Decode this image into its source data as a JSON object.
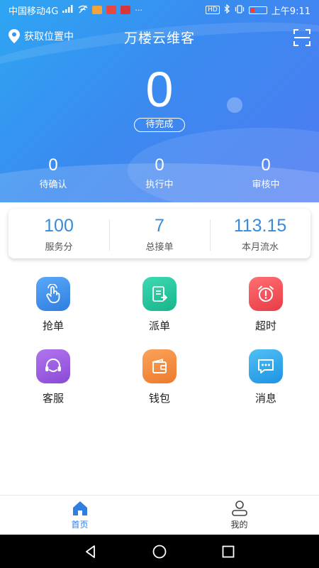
{
  "status_bar": {
    "carrier": "中国移动4G",
    "network": "4G",
    "time": "上午9:11",
    "hd_badge": "HD",
    "icons": [
      "signal-icon",
      "wifi-off-icon",
      "alert-icon",
      "app-badge-icon",
      "bluetooth-icon",
      "vibrate-icon",
      "battery-icon"
    ]
  },
  "header": {
    "location_label": "获取位置中",
    "title": "万楼云维客",
    "scan_icon": "scan-icon"
  },
  "hero": {
    "pending_count": "0",
    "pending_label": "待完成",
    "stats": [
      {
        "value": "0",
        "label": "待确认"
      },
      {
        "value": "0",
        "label": "执行中"
      },
      {
        "value": "0",
        "label": "审核中"
      }
    ]
  },
  "summary": [
    {
      "value": "100",
      "label": "服务分"
    },
    {
      "value": "7",
      "label": "总接单"
    },
    {
      "value": "113.15",
      "label": "本月流水"
    }
  ],
  "grid": [
    {
      "label": "抢单",
      "icon": "tap-hand-icon",
      "color": "#3f8ff0"
    },
    {
      "label": "派单",
      "icon": "dispatch-doc-icon",
      "color": "#26c49a"
    },
    {
      "label": "超时",
      "icon": "alarm-clock-icon",
      "color": "#f2505a"
    },
    {
      "label": "客服",
      "icon": "headset-icon",
      "color": "#9b5de0"
    },
    {
      "label": "钱包",
      "icon": "wallet-icon",
      "color": "#f08a3c"
    },
    {
      "label": "消息",
      "icon": "chat-bubble-icon",
      "color": "#2ba4ee"
    }
  ],
  "tabbar": {
    "items": [
      {
        "label": "首页",
        "icon": "home-icon",
        "active": true
      },
      {
        "label": "我的",
        "icon": "user-icon",
        "active": false
      }
    ]
  },
  "colors": {
    "accent": "#2f7ee0",
    "summary_value": "#3a8bd8"
  }
}
